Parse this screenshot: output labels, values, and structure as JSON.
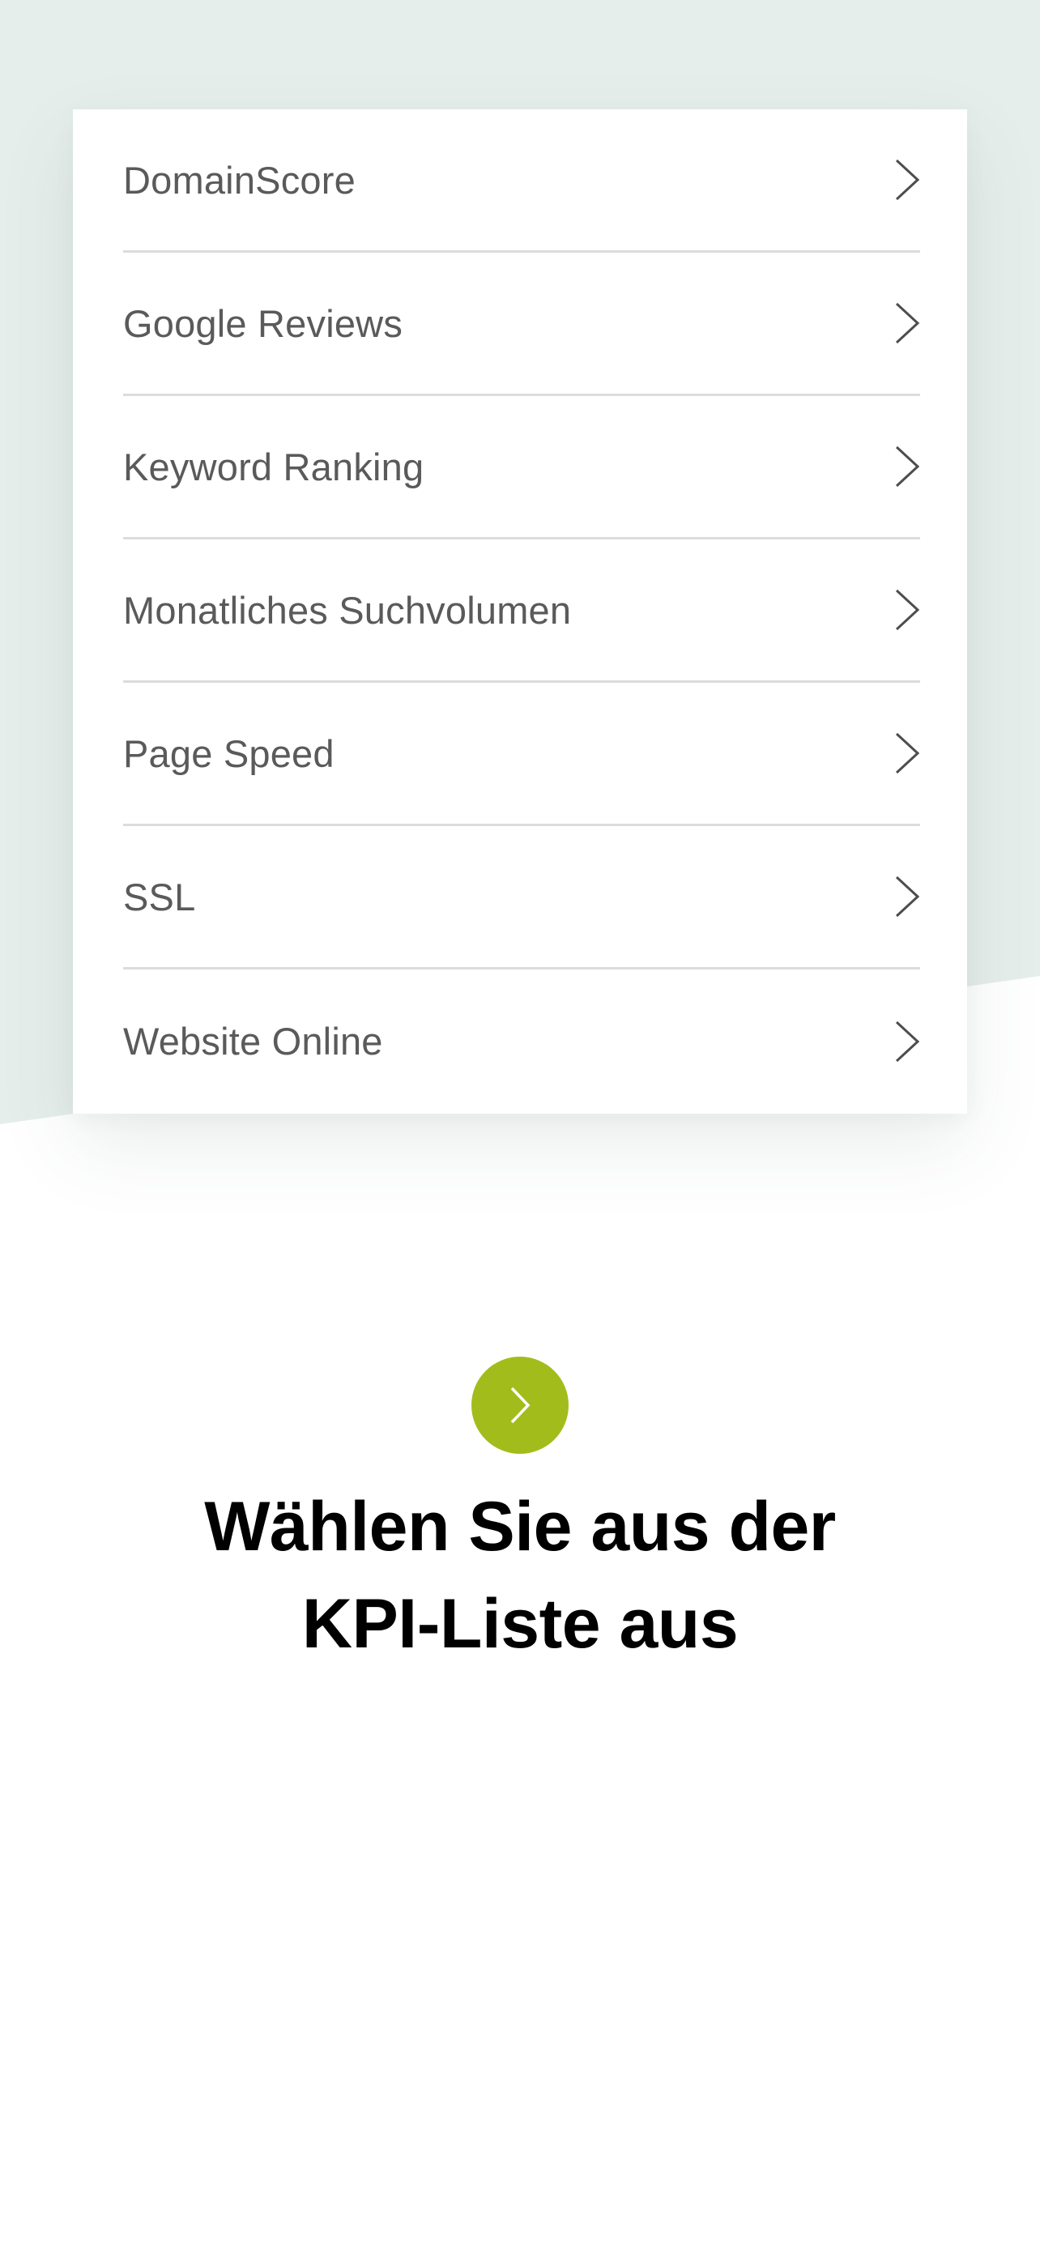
{
  "kpi_list": {
    "items": [
      {
        "label": "DomainScore"
      },
      {
        "label": "Google Reviews"
      },
      {
        "label": "Keyword Ranking"
      },
      {
        "label": "Monatliches Suchvolumen"
      },
      {
        "label": "Page Speed"
      },
      {
        "label": "SSL"
      },
      {
        "label": "Website Online"
      }
    ],
    "item_icon": "chevron-right-icon"
  },
  "cta": {
    "icon": "chevron-right-icon",
    "title_line1": "Wählen Sie aus der",
    "title_line2": "KPI-Liste aus"
  },
  "colors": {
    "background_tint": "#e6eeeb",
    "accent": "#a2bd1b",
    "label_text": "#5a5a5a",
    "divider": "#dcdcdc",
    "title_text": "#000000"
  }
}
